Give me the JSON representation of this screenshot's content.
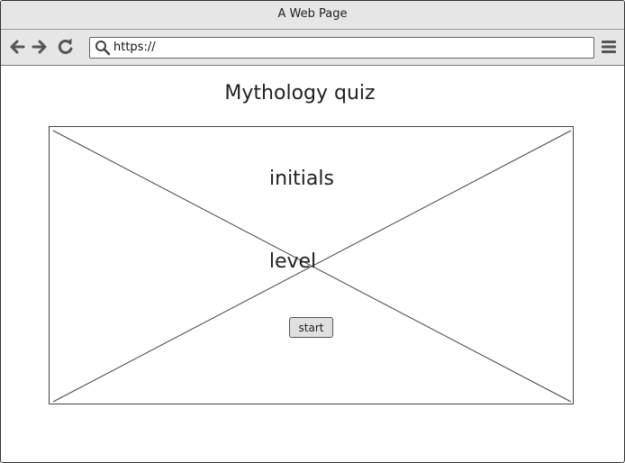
{
  "window": {
    "title": "A Web Page"
  },
  "browser": {
    "url": "https://",
    "icons": {
      "back": "arrow-left-icon",
      "forward": "arrow-right-icon",
      "reload": "reload-icon",
      "search": "search-icon",
      "menu": "hamburger-menu-icon"
    }
  },
  "page": {
    "title": "Mythology quiz",
    "initials_label": "initials",
    "level_label": "level",
    "start_label": "start"
  }
}
